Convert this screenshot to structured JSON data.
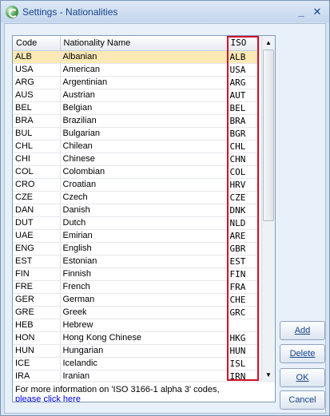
{
  "window": {
    "title": "Settings - Nationalities",
    "minimize_label": "_",
    "close_label": "✕"
  },
  "grid": {
    "columns": [
      "Code",
      "Nationality Name",
      "ISO"
    ],
    "rows": [
      [
        "ALB",
        "Albanian",
        "ALB"
      ],
      [
        "USA",
        "American",
        "USA"
      ],
      [
        "ARG",
        "Argentinian",
        "ARG"
      ],
      [
        "AUS",
        "Austrian",
        "AUT"
      ],
      [
        "BEL",
        "Belgian",
        "BEL"
      ],
      [
        "BRA",
        "Brazilian",
        "BRA"
      ],
      [
        "BUL",
        "Bulgarian",
        "BGR"
      ],
      [
        "CHL",
        "Chilean",
        "CHL"
      ],
      [
        "CHI",
        "Chinese",
        "CHN"
      ],
      [
        "COL",
        "Colombian",
        "COL"
      ],
      [
        "CRO",
        "Croatian",
        "HRV"
      ],
      [
        "CZE",
        "Czech",
        "CZE"
      ],
      [
        "DAN",
        "Danish",
        "DNK"
      ],
      [
        "DUT",
        "Dutch",
        "NLD"
      ],
      [
        "UAE",
        "Emirian",
        "ARE"
      ],
      [
        "ENG",
        "English",
        "GBR"
      ],
      [
        "EST",
        "Estonian",
        "EST"
      ],
      [
        "FIN",
        "Finnish",
        "FIN"
      ],
      [
        "FRE",
        "French",
        "FRA"
      ],
      [
        "GER",
        "German",
        "CHE"
      ],
      [
        "GRE",
        "Greek",
        "GRC"
      ],
      [
        "HEB",
        "Hebrew",
        ""
      ],
      [
        "HON",
        "Hong Kong Chinese",
        "HKG"
      ],
      [
        "HUN",
        "Hungarian",
        "HUN"
      ],
      [
        "ICE",
        "Icelandic",
        "ISL"
      ],
      [
        "IRA",
        "Iranian",
        "IRN"
      ]
    ],
    "selected_row": 0
  },
  "info": {
    "text": "For more information on 'ISO 3166-1 alpha 3' codes,",
    "link": "please click here"
  },
  "buttons": {
    "add": "Add",
    "delete": "Delete",
    "ok": "OK",
    "cancel": "Cancel"
  },
  "colors": {
    "selected_row": "#fde9b5",
    "iso_highlight": "#d0102a",
    "button_text": "#15428b"
  }
}
